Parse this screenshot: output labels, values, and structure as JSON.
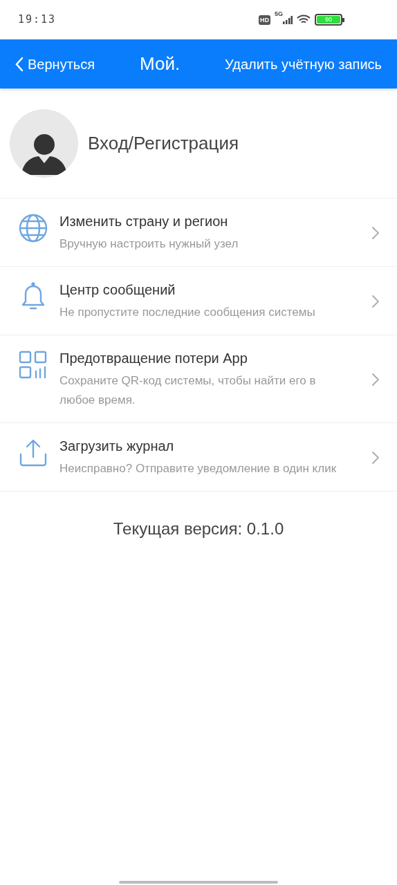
{
  "status_bar": {
    "time": "19:13",
    "hd": "HD",
    "network": "5G",
    "battery": "90"
  },
  "header": {
    "back": "Вернуться",
    "title": "Мой.",
    "action": "Удалить учётную запись"
  },
  "profile": {
    "label": "Вход/Регистрация"
  },
  "items": [
    {
      "kind": "globe",
      "title": "Изменить страну и регион",
      "subtitle": "Вручную настроить нужный узел"
    },
    {
      "kind": "bell",
      "title": "Центр сообщений",
      "subtitle": "Не пропустите последние сообщения системы"
    },
    {
      "kind": "qr",
      "title": "Предотвращение потери App",
      "subtitle": "Сохраните QR-код системы, чтобы найти его в любое время."
    },
    {
      "kind": "upload",
      "title": "Загрузить журнал",
      "subtitle": "Неисправно? Отправите уведомление в один клик"
    }
  ],
  "version": "Текущая версия: 0.1.0"
}
